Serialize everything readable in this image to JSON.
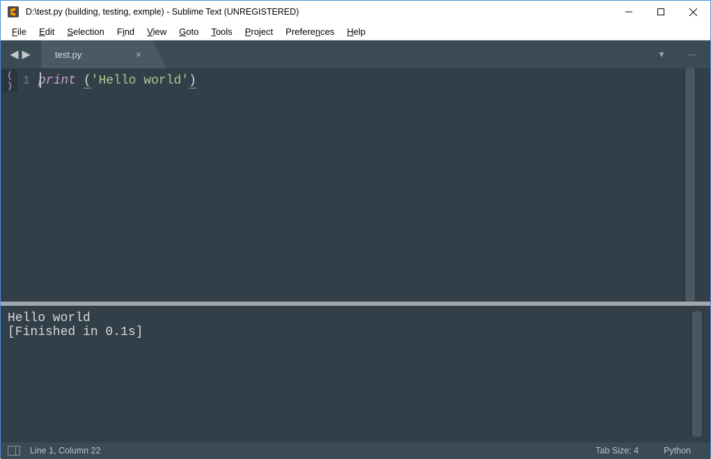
{
  "window": {
    "title": "D:\\test.py (building, testing, exmple) - Sublime Text (UNREGISTERED)"
  },
  "menu": {
    "items": [
      {
        "label": "File",
        "accel": "F"
      },
      {
        "label": "Edit",
        "accel": "E"
      },
      {
        "label": "Selection",
        "accel": "S"
      },
      {
        "label": "Find",
        "accel": "i"
      },
      {
        "label": "View",
        "accel": "V"
      },
      {
        "label": "Goto",
        "accel": "G"
      },
      {
        "label": "Tools",
        "accel": "T"
      },
      {
        "label": "Project",
        "accel": "P"
      },
      {
        "label": "Preferences",
        "accel": "n"
      },
      {
        "label": "Help",
        "accel": "H"
      }
    ]
  },
  "tabs": {
    "active": {
      "label": "test.py"
    }
  },
  "editor": {
    "lines": [
      {
        "number": "1",
        "fold_indicator": "( )",
        "tokens": {
          "kw": "print",
          "sp1": " ",
          "lp": "(",
          "str": "'Hello world'",
          "rp": ")"
        }
      }
    ]
  },
  "console": {
    "line1": "Hello world",
    "line2": "[Finished in 0.1s]"
  },
  "statusbar": {
    "position": "Line 1, Column 22",
    "tabsize": "Tab Size: 4",
    "syntax": "Python"
  }
}
